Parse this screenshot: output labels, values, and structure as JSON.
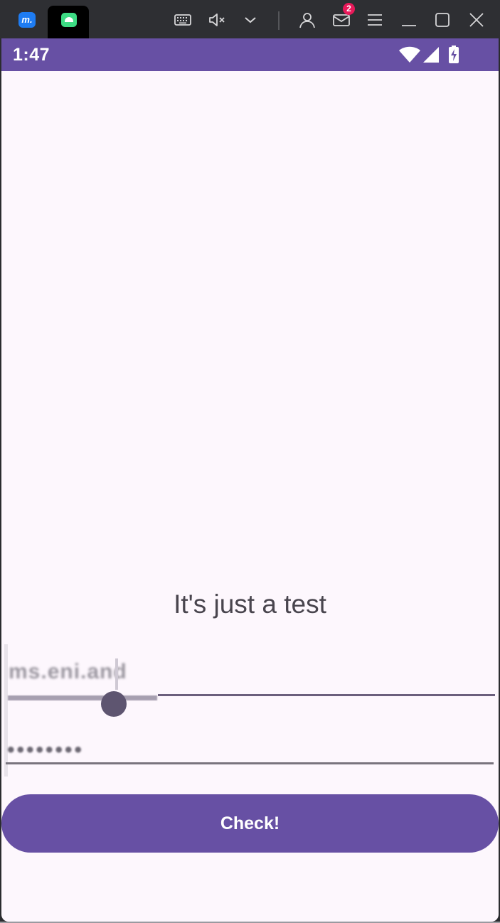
{
  "window": {
    "app_logo_text": "m.",
    "icons": [
      "keyboard-icon",
      "mute-icon",
      "chevron-down-icon",
      "account-icon",
      "mail-icon",
      "menu-icon",
      "minimize-icon",
      "maximize-icon",
      "close-icon"
    ],
    "mail_badge": "2"
  },
  "statusbar": {
    "time": "1:47",
    "icons": [
      "wifi-icon",
      "signal-icon",
      "battery-charging-icon"
    ],
    "color": "#6750a4"
  },
  "main": {
    "label": "It's just a test",
    "username_field": {
      "value": "ms.eni.and"
    },
    "password_field": {
      "value": "••••••••"
    },
    "check_button_label": "Check!"
  },
  "colors": {
    "accent": "#6750a4",
    "background": "#fdf7fd",
    "text": "#49454e"
  }
}
